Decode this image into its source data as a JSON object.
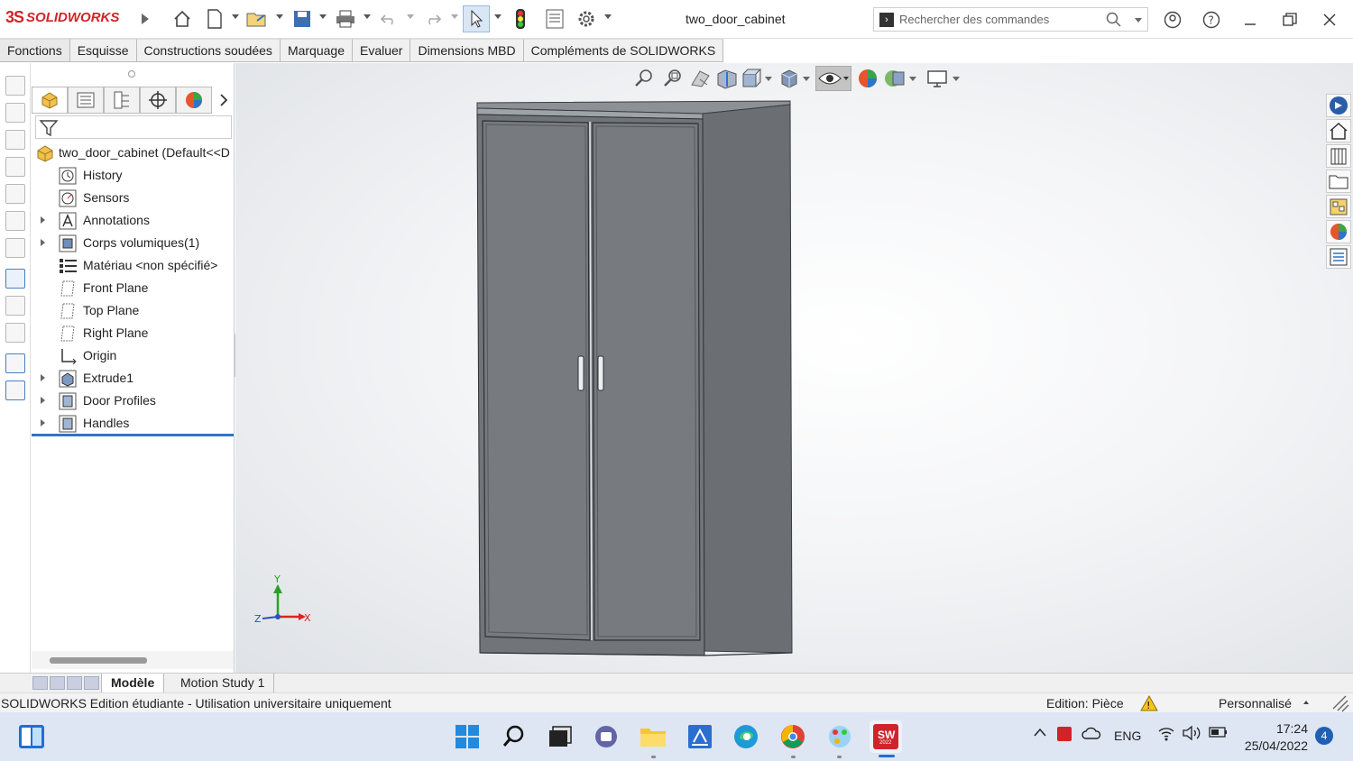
{
  "app": {
    "logo_ds": "3S",
    "logo_text": "SOLIDWORKS",
    "document_title": "two_door_cabinet",
    "search_placeholder": "Rechercher des commandes"
  },
  "menu_tabs": [
    "Fonctions",
    "Esquisse",
    "Constructions soudées",
    "Marquage",
    "Evaluer",
    "Dimensions MBD",
    "Compléments de SOLIDWORKS"
  ],
  "feature_tree": {
    "root_label": "two_door_cabinet  (Default<<D",
    "items": [
      {
        "label": "History",
        "icon": "history-icon",
        "expandable": false
      },
      {
        "label": "Sensors",
        "icon": "sensors-icon",
        "expandable": false
      },
      {
        "label": "Annotations",
        "icon": "annotations-icon",
        "expandable": true
      },
      {
        "label": "Corps volumiques(1)",
        "icon": "solid-bodies-icon",
        "expandable": true
      },
      {
        "label": "Matériau <non spécifié>",
        "icon": "material-icon",
        "expandable": false
      },
      {
        "label": "Front Plane",
        "icon": "plane-icon",
        "expandable": false
      },
      {
        "label": "Top Plane",
        "icon": "plane-icon",
        "expandable": false
      },
      {
        "label": "Right Plane",
        "icon": "plane-icon",
        "expandable": false
      },
      {
        "label": "Origin",
        "icon": "origin-icon",
        "expandable": false
      },
      {
        "label": "Extrude1",
        "icon": "extrude-icon",
        "expandable": true
      },
      {
        "label": "Door Profiles",
        "icon": "feature-icon",
        "expandable": true
      },
      {
        "label": "Handles",
        "icon": "feature-icon",
        "expandable": true
      }
    ]
  },
  "triad": {
    "y": "Y",
    "x": "X",
    "z": "Z"
  },
  "bottom_tabs": [
    "Modèle",
    "Motion Study 1"
  ],
  "status": {
    "left": "SOLIDWORKS Edition étudiante - Utilisation universitaire uniquement",
    "mode": "Edition: Pièce",
    "units": "Personnalisé"
  },
  "taskbar": {
    "lang": "ENG",
    "time": "17:24",
    "date": "25/04/2022",
    "notifications": "4",
    "sw_label": "SW",
    "sw_year": "2022"
  },
  "colors": {
    "accent_red": "#d2232a",
    "selection_blue": "#2f74c5",
    "cabinet_gray": "#6e7277"
  }
}
